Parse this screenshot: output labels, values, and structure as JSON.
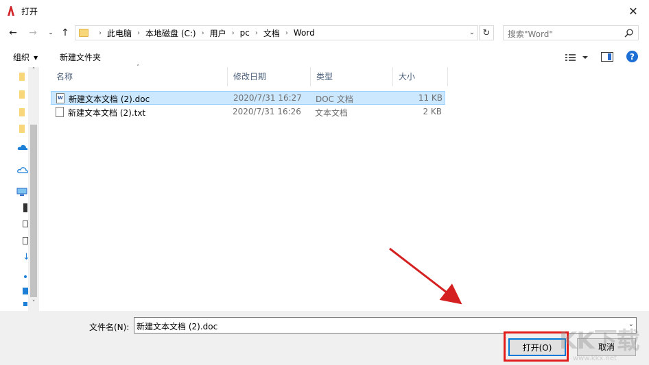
{
  "window": {
    "title": "打开"
  },
  "address": {
    "crumbs": [
      "此电脑",
      "本地磁盘 (C:)",
      "用户",
      "pc",
      "文档",
      "Word"
    ],
    "search_placeholder": "搜索\"Word\""
  },
  "toolbar": {
    "organize_label": "组织",
    "new_folder_label": "新建文件夹"
  },
  "columns": {
    "name": "名称",
    "date": "修改日期",
    "type": "类型",
    "size": "大小"
  },
  "files": [
    {
      "name": "新建文本文档 (2).doc",
      "date": "2020/7/31 16:27",
      "type": "DOC 文档",
      "size": "11 KB",
      "icon": "word-doc-icon",
      "selected": true
    },
    {
      "name": "新建文本文档 (2).txt",
      "date": "2020/7/31 16:26",
      "type": "文本文档",
      "size": "2 KB",
      "icon": "text-file-icon",
      "selected": false
    }
  ],
  "bottom": {
    "filename_label": "文件名(N):",
    "filename_value": "新建文本文档 (2).doc",
    "open_label": "打开(O)",
    "cancel_label": "取消"
  },
  "watermark": {
    "main": "KK下载",
    "sub": "www.kkx.net"
  },
  "colors": {
    "accent": "#0078d7",
    "selection": "#cce8ff",
    "highlight": "#e21b1b"
  }
}
